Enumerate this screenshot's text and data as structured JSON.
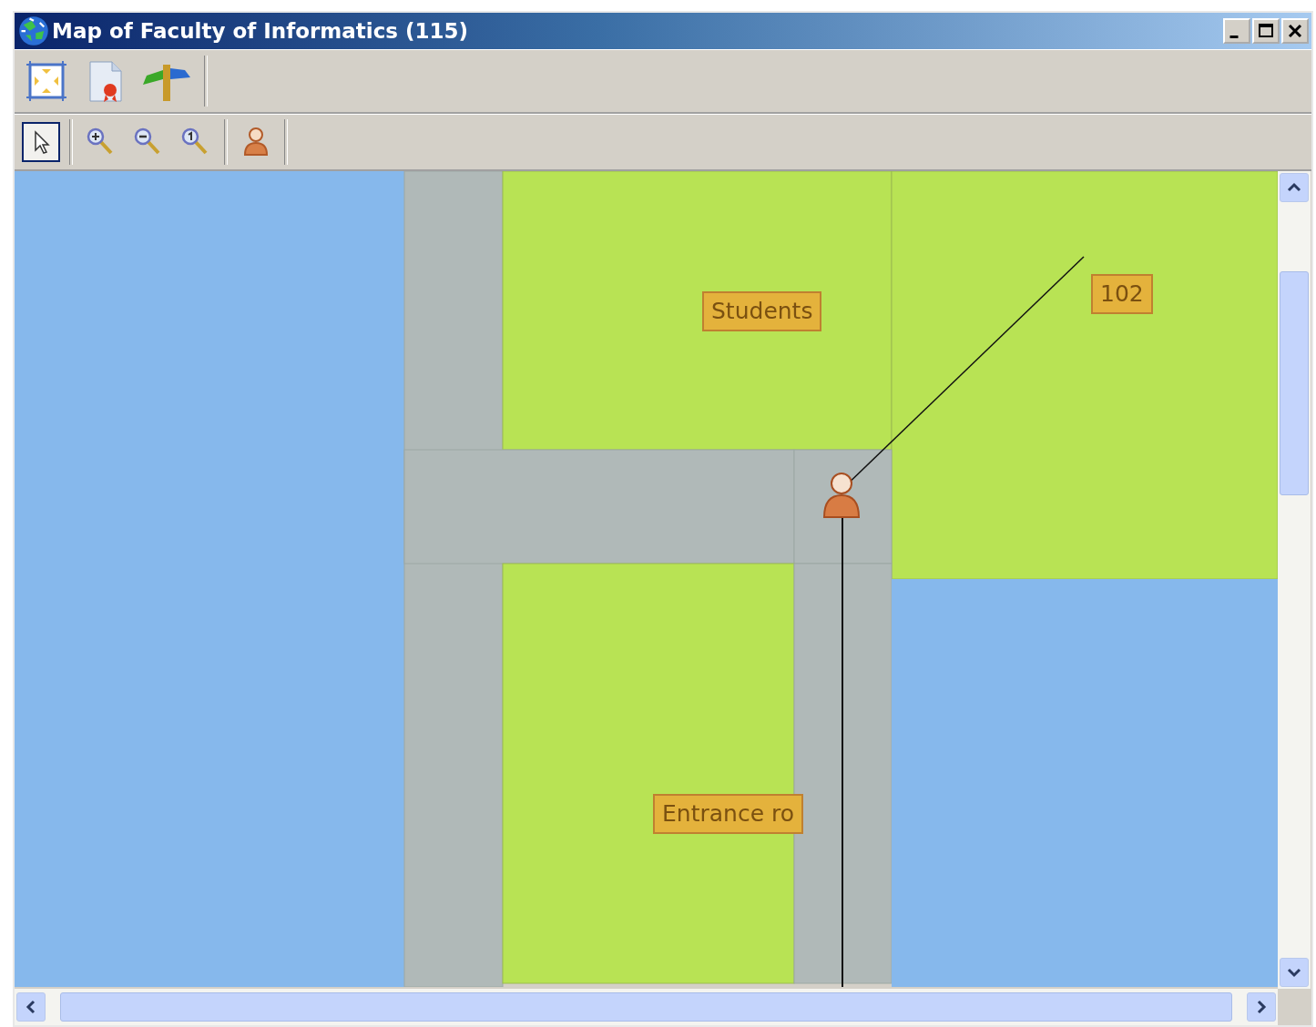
{
  "window": {
    "title": "Map of Faculty of Informatics (115)"
  },
  "toolbar_top": {
    "tools": [
      {
        "kind": "fit"
      },
      {
        "kind": "report"
      },
      {
        "kind": "signpost"
      }
    ]
  },
  "toolbar_bottom": {
    "tools": [
      {
        "kind": "pointer",
        "selected": true
      },
      {
        "kind": "zoom-in",
        "selected": false
      },
      {
        "kind": "zoom-out",
        "selected": false
      },
      {
        "kind": "zoom-reset",
        "selected": false
      },
      {
        "kind": "person",
        "selected": false
      }
    ]
  },
  "map": {
    "labels": [
      {
        "text": "Students"
      },
      {
        "text": "102"
      },
      {
        "text": "Entrance ro"
      }
    ]
  }
}
